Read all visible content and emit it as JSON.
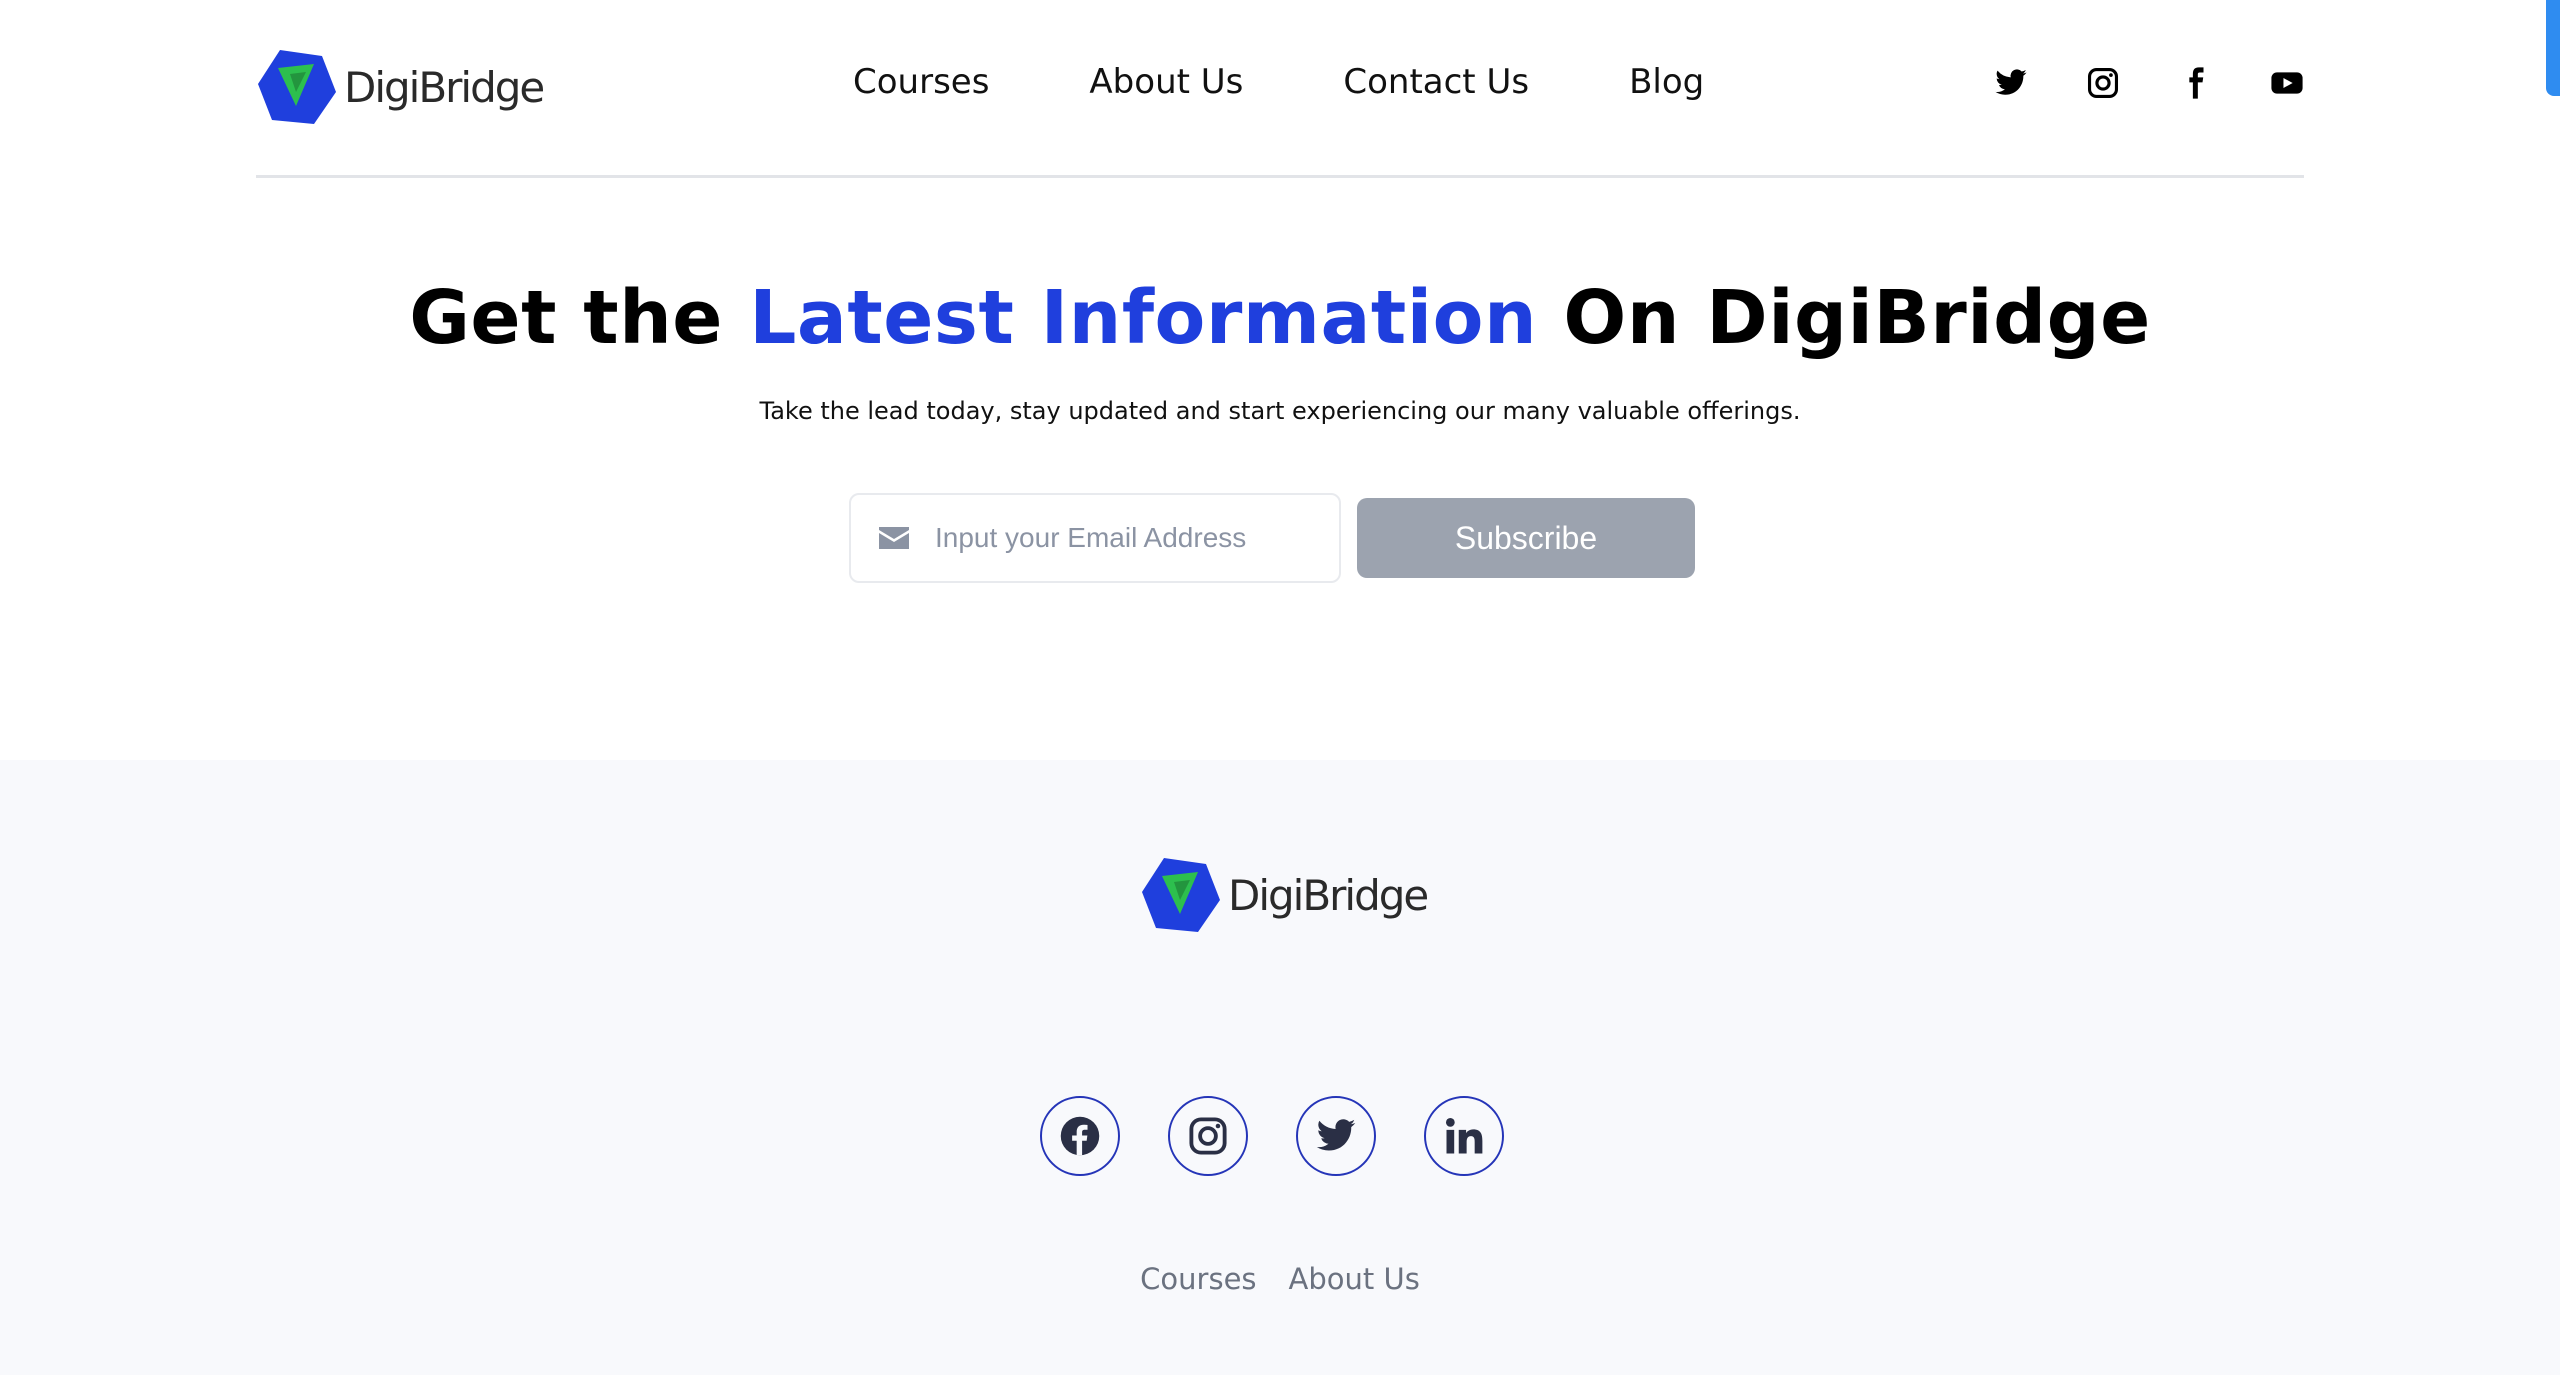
{
  "header": {
    "brand": "DigiBridge",
    "nav": [
      "Courses",
      "About Us",
      "Contact Us",
      "Blog"
    ],
    "social_icons": [
      "twitter-icon",
      "instagram-icon",
      "facebook-icon",
      "youtube-icon"
    ]
  },
  "hero": {
    "title_part1": "Get the ",
    "title_accent": "Latest Information",
    "title_part2": " On DigiBridge",
    "subtitle": "Take the lead today, stay updated and start experiencing our many valuable offerings.",
    "email_placeholder": "Input your Email Address",
    "email_value": "",
    "subscribe_label": "Subscribe"
  },
  "footer": {
    "brand": "DigiBridge",
    "social_icons": [
      "facebook-icon",
      "instagram-icon",
      "twitter-icon",
      "linkedin-icon"
    ],
    "links": [
      "Courses",
      "About Us"
    ]
  },
  "colors": {
    "accent": "#1f3fdd",
    "logo_blue": "#1f3fdd",
    "logo_green": "#2dbf4e",
    "button_disabled": "#9ca3af",
    "footer_bg": "#f8f9fc",
    "footer_icon_ring": "#2535b8",
    "scroll_indicator": "#2f8cf0"
  }
}
